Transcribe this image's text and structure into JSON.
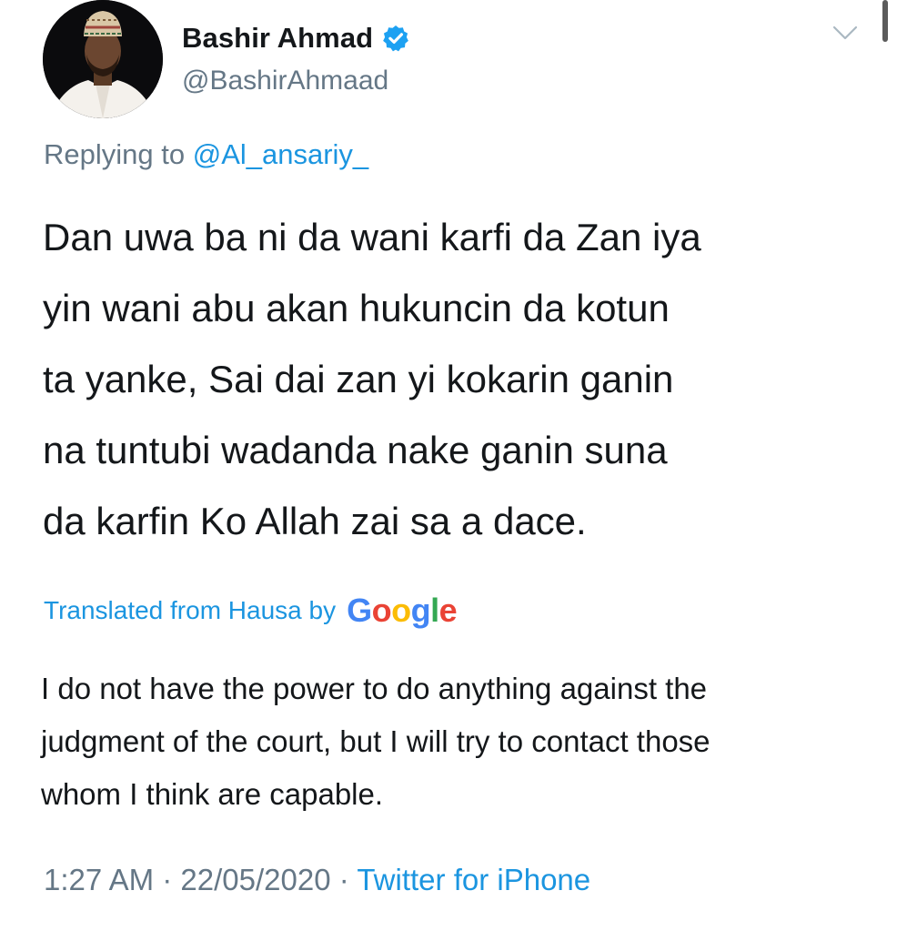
{
  "author": {
    "display_name": "Bashir Ahmad",
    "handle": "@BashirAhmaad",
    "verified": true
  },
  "reply": {
    "prefix": "Replying to",
    "target": "@Al_ansariy_"
  },
  "tweet": {
    "lines": [
      "Dan uwa ba ni da wani karfi da Zan iya",
      "yin wani abu akan hukuncin da kotun",
      "ta yanke, Sai dai zan yi kokarin ganin",
      "na tuntubi wadanda nake ganin suna",
      "da karfin Ko Allah zai sa a dace."
    ]
  },
  "translation": {
    "label": "Translated from Hausa by",
    "provider_letters": [
      "G",
      "o",
      "o",
      "g",
      "l",
      "e"
    ],
    "lines": [
      "I do not have the power to do anything against the",
      "judgment of the court, but I will try to contact those",
      "whom I think are capable."
    ]
  },
  "meta": {
    "time": "1:27 AM",
    "separator": "·",
    "date": "22/05/2020",
    "source": "Twitter for iPhone"
  },
  "icons": {
    "verified": "verified-badge-icon",
    "menu": "chevron-down-icon"
  },
  "colors": {
    "link": "#1b95e0",
    "secondary_text": "#657786",
    "primary_text": "#14171a",
    "verified": "#1da1f2"
  }
}
